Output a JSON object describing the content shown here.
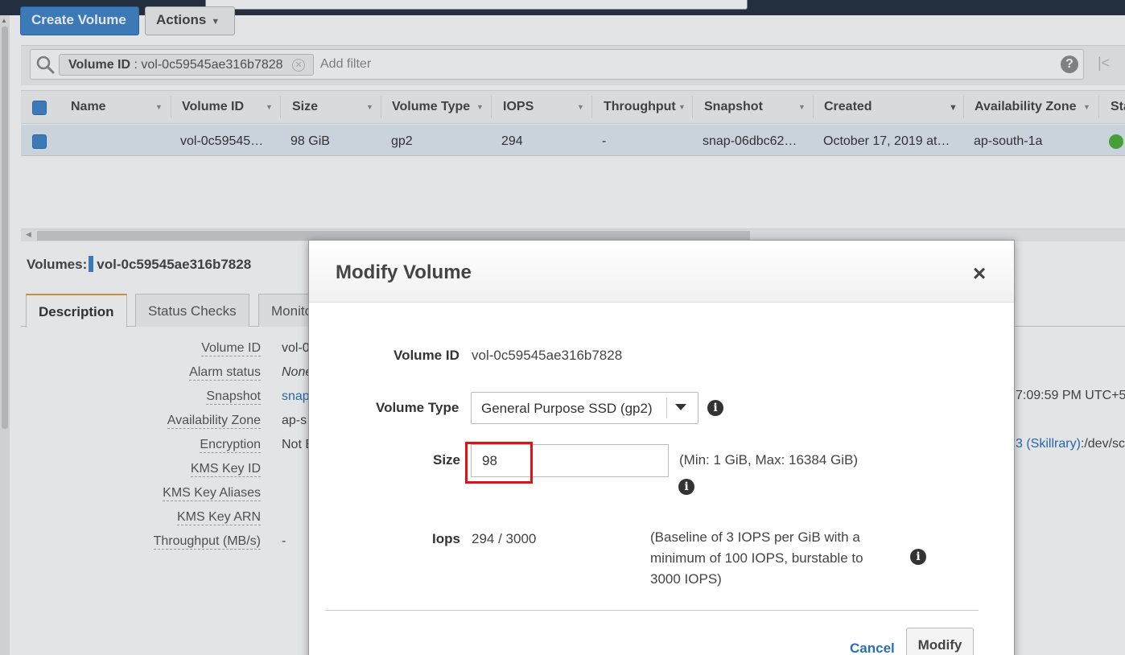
{
  "toolbar": {
    "create_label": "Create Volume",
    "actions_label": "Actions"
  },
  "filter": {
    "chip_key": "Volume ID",
    "chip_value": ": vol-0c59545ae316b7828",
    "placeholder": "Add filter",
    "help": "?"
  },
  "grid": {
    "columns": [
      "Name",
      "Volume ID",
      "Size",
      "Volume Type",
      "IOPS",
      "Throughput",
      "Snapshot",
      "Created",
      "Availability Zone",
      "Sta"
    ],
    "row": {
      "name": "",
      "volume_id": "vol-0c59545…",
      "size": "98 GiB",
      "volume_type": "gp2",
      "iops": "294",
      "throughput": "-",
      "snapshot": "snap-06dbc62…",
      "created": "October 17, 2019 at…",
      "availability_zone": "ap-south-1a",
      "state_color": "#4caf3a"
    }
  },
  "details": {
    "title_prefix": "Volumes:",
    "title_volume": "vol-0c59545ae316b7828",
    "tabs": [
      "Description",
      "Status Checks",
      "Monito"
    ],
    "fields": [
      {
        "label": "Volume ID",
        "value": "vol-0"
      },
      {
        "label": "Alarm status",
        "value": "None"
      },
      {
        "label": "Snapshot",
        "value": "snap"
      },
      {
        "label": "Availability Zone",
        "value": "ap-s"
      },
      {
        "label": "Encryption",
        "value": "Not E"
      },
      {
        "label": "KMS Key ID",
        "value": ""
      },
      {
        "label": "KMS Key Aliases",
        "value": ""
      },
      {
        "label": "KMS Key ARN",
        "value": ""
      },
      {
        "label": "Throughput (MB/s)",
        "value": "-"
      }
    ],
    "right_created": "7:09:59 PM UTC+5",
    "right_attachment_link": "3 (Skillrary)",
    "right_attachment_rest": ":/dev/sc"
  },
  "modal": {
    "title": "Modify Volume",
    "close": "×",
    "volume_id_label": "Volume ID",
    "volume_id_value": "vol-0c59545ae316b7828",
    "volume_type_label": "Volume Type",
    "volume_type_value": "General Purpose SSD (gp2)",
    "size_label": "Size",
    "size_value": "98",
    "size_note": "(Min: 1 GiB, Max: 16384 GiB)",
    "iops_label": "Iops",
    "iops_value": "294 / 3000",
    "iops_note_lines": [
      "(Baseline of 3 IOPS per GiB with a",
      "minimum of 100 IOPS, burstable to",
      "3000 IOPS)"
    ],
    "cancel_label": "Cancel",
    "modify_label": "Modify",
    "highlight_color": "#e21212"
  }
}
